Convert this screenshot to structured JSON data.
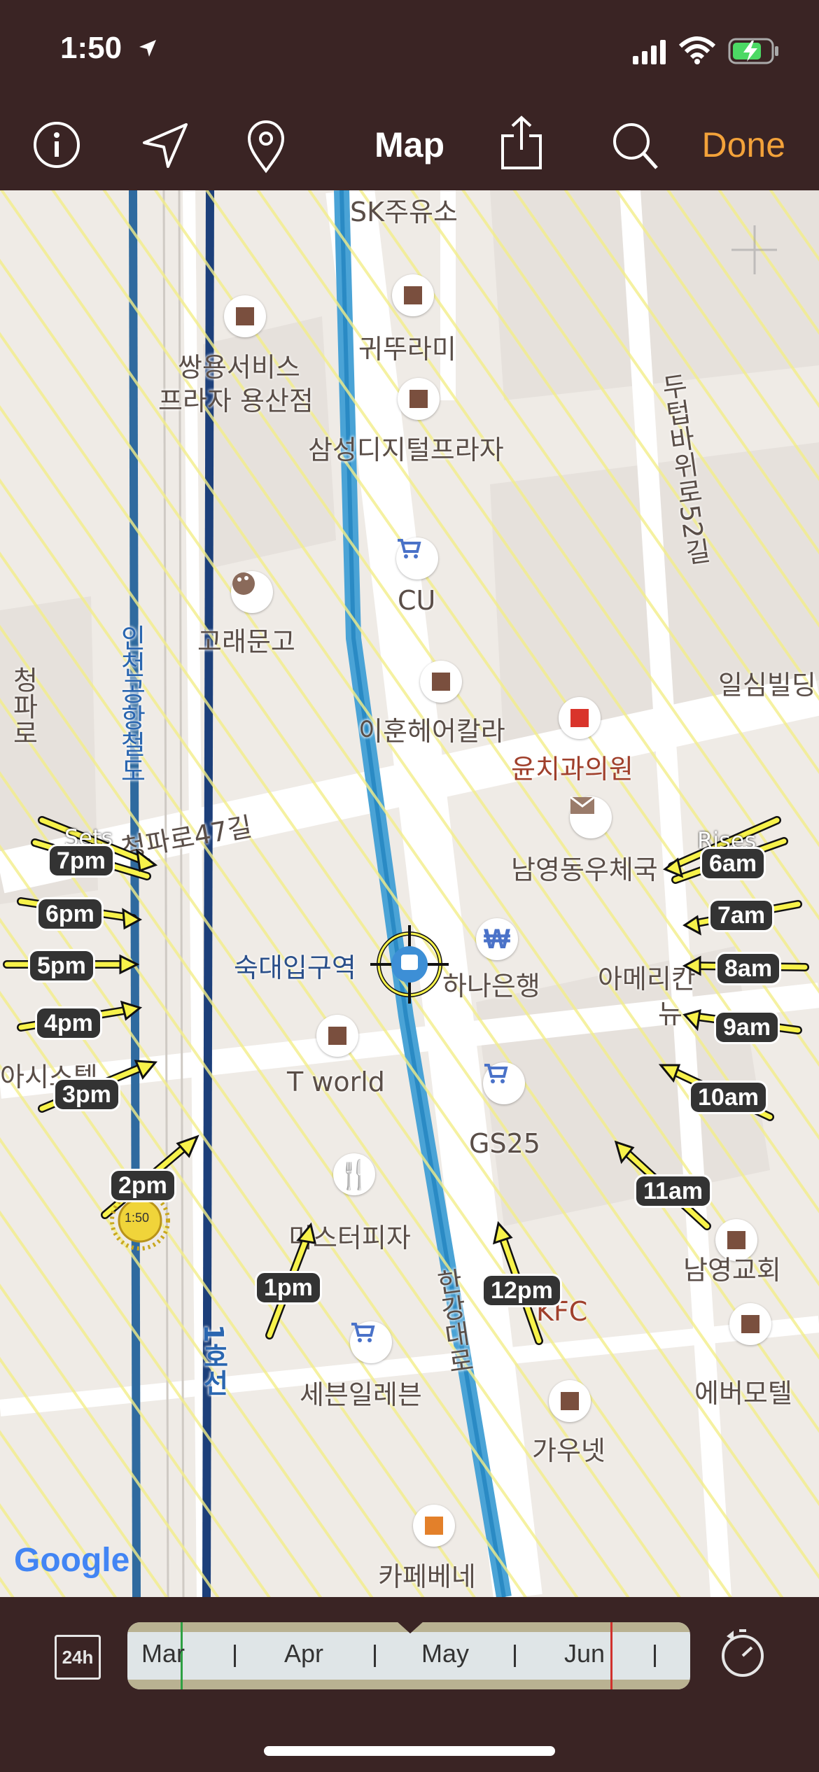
{
  "status": {
    "time": "1:50"
  },
  "nav": {
    "title": "Map",
    "done": "Done"
  },
  "map": {
    "places": [
      "SK주유소",
      "쌍용서비스",
      "프라자 용산점",
      "귀뚜라미",
      "삼성디지털프라자",
      "두텁바위로52길",
      "CU",
      "고래문고",
      "인천공항철도",
      "청파로",
      "일심빌딩",
      "이훈헤어칼라",
      "윤치과의원",
      "청파로47길",
      "남영동우체국",
      "숙대입구역",
      "하나은행",
      "아메리칸",
      "뉴",
      "T world",
      "GS25",
      "아시스텔",
      "미스터피자",
      "남영교회",
      "한강대로",
      "KFC",
      "1호선",
      "세븐일레븐",
      "에버모텔",
      "가우넷",
      "카페베네"
    ],
    "sun_left_labels": [
      "7pm",
      "6pm",
      "5pm",
      "4pm",
      "3pm",
      "2pm",
      "1pm"
    ],
    "sun_right_labels": [
      "6am",
      "7am",
      "8am",
      "9am",
      "10am",
      "11am",
      "12pm"
    ],
    "sets_label": "Sets",
    "rises_label": "Rises",
    "sun_time": "1:50",
    "google": "Google"
  },
  "bottom": {
    "toggle_24h": "24h",
    "months": [
      "Mar",
      "Apr",
      "May",
      "Jun"
    ]
  },
  "colors": {
    "accent": "#f3a23a",
    "chrome": "#3a2424",
    "sunline": "#f7f24a"
  }
}
